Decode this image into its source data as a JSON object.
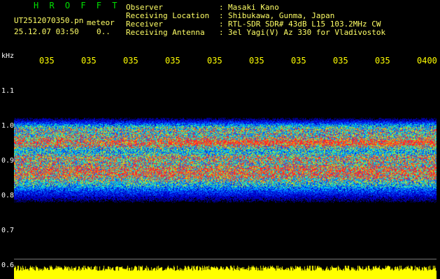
{
  "header": {
    "app_title": "H R O F F T",
    "filename": "UT2512070350.pn",
    "file_tag": "meteor",
    "datetime": "25.12.07 03:50",
    "datetime_suffix": "0..",
    "labels": [
      "Observer",
      "Receiving Location",
      "Receiver",
      "Receiving Antenna"
    ],
    "separator": ":",
    "values": [
      "Masaki Kano",
      "Shibukawa, Gunma, Japan",
      "RTL-SDR SDR# 43dB L15 103.2MHz CW",
      "3el Yagi(V) Az 330 for Vladivostok"
    ]
  },
  "axis": {
    "unit": "kHz",
    "time_ticks": [
      "035",
      "035",
      "035",
      "035",
      "035",
      "035",
      "035",
      "035",
      "035",
      "0400"
    ],
    "freq_ticks": [
      "1.1",
      "1.0",
      "0.9",
      "0.8",
      "0.7",
      "0.6"
    ]
  },
  "colors": {
    "background": "#000000",
    "header_text": "#ffff66",
    "title": "#00e000",
    "ticks": "#ffff00",
    "noise_floor": "#0000c0",
    "signal": "#ff2020",
    "bottom_band": "#ffff00"
  }
}
